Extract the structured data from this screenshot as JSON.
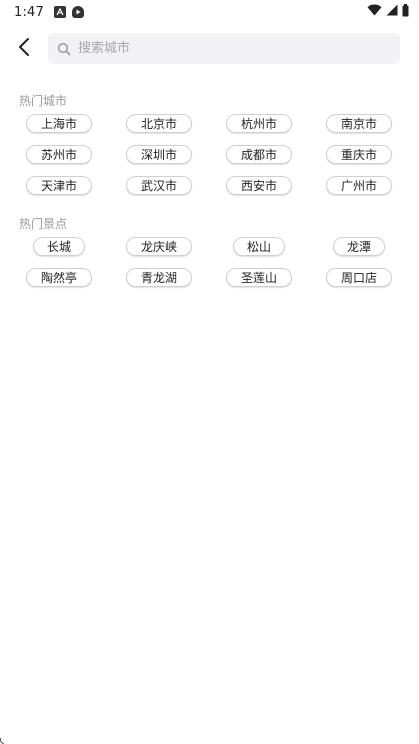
{
  "status_bar": {
    "time": "1:47",
    "left_icons": [
      "a-notification-icon",
      "play-notification-icon"
    ],
    "right_icons": [
      "wifi-icon",
      "signal-icon",
      "battery-icon"
    ]
  },
  "header": {
    "back_icon": "chevron-left-icon",
    "search": {
      "placeholder": "搜索城市",
      "value": ""
    }
  },
  "hot_cities": {
    "title": "热门城市",
    "items": [
      "上海市",
      "北京市",
      "杭州市",
      "南京市",
      "苏州市",
      "深圳市",
      "成都市",
      "重庆市",
      "天津市",
      "武汉市",
      "西安市",
      "广州市"
    ]
  },
  "hot_spots": {
    "title": "热门景点",
    "items": [
      "长城",
      "龙庆峡",
      "松山",
      "龙潭",
      "陶然亭",
      "青龙湖",
      "圣莲山",
      "周口店"
    ]
  },
  "colors": {
    "search_bg": "#f2f2f4",
    "tag_border": "#d0d0d0",
    "section_title": "#9a9a9a"
  }
}
